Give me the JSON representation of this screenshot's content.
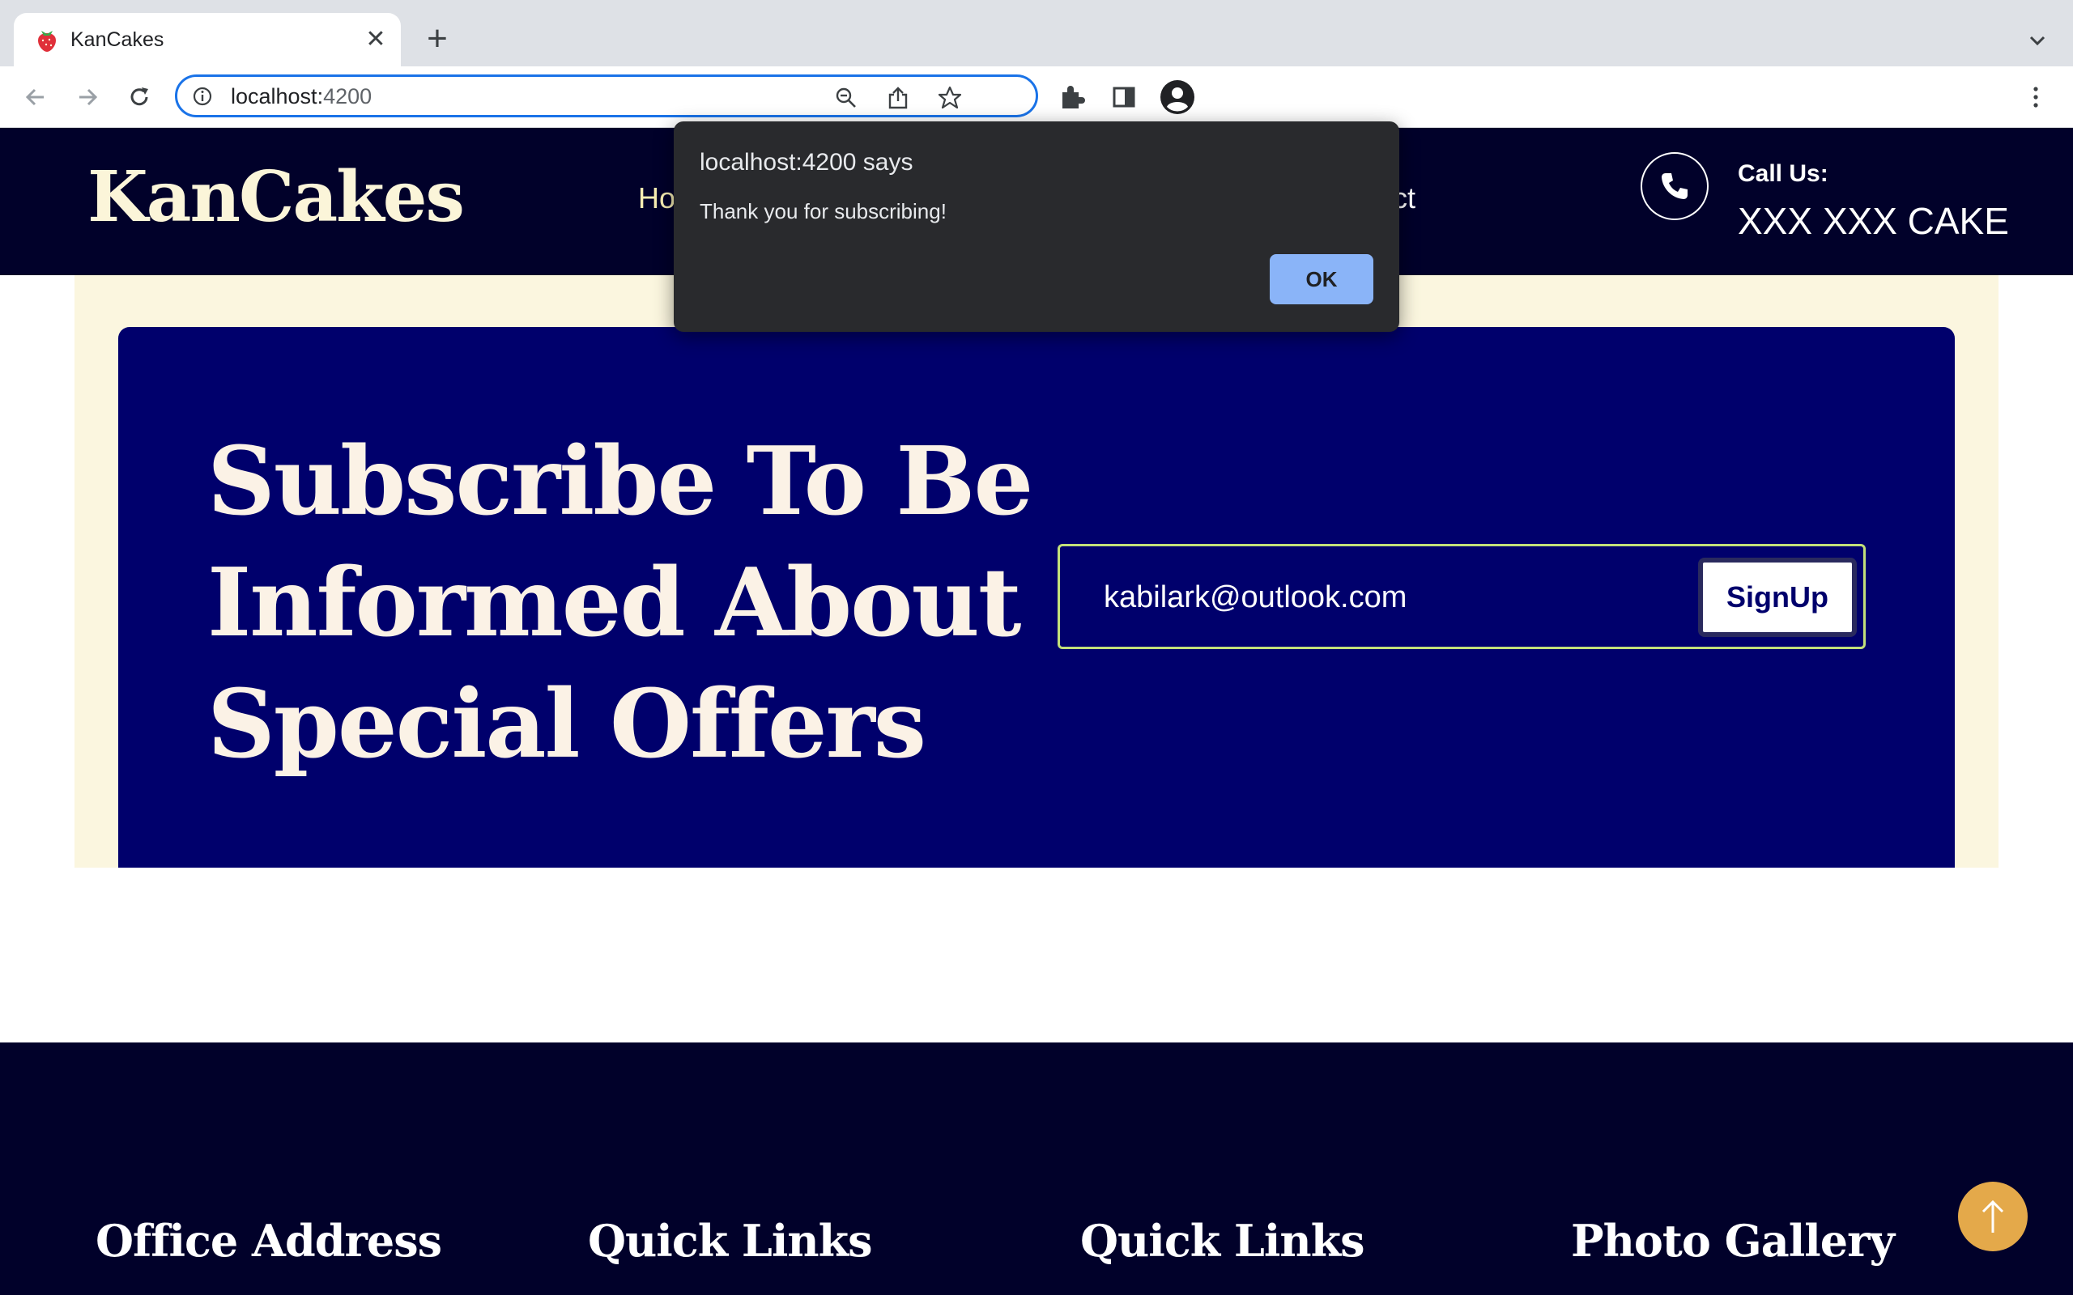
{
  "browser": {
    "tab_title": "KanCakes",
    "new_tab_symbol": "+",
    "close_symbol": "✕",
    "url_host": "localhost:",
    "url_port": "4200",
    "icons": [
      "back-icon",
      "forward-icon",
      "reload-icon",
      "site-info-icon",
      "zoom-out-icon",
      "share-icon",
      "bookmark-star-icon",
      "extensions-icon",
      "side-panel-icon",
      "profile-icon",
      "menu-icon",
      "tab-search-icon",
      "strawberry-favicon-icon"
    ]
  },
  "header": {
    "logo": "KanCakes",
    "nav_home_partial": "Ho",
    "nav_contact_partial": "ntact",
    "call_label": "Call Us:",
    "call_number": "XXX XXX CAKE"
  },
  "subscribe": {
    "heading": "Subscribe To Be Informed About Special Offers",
    "email_value": "kabilark@outlook.com",
    "signup_label": "SignUp"
  },
  "footer": {
    "col1_title": "Office Address",
    "col2_title": "Quick Links",
    "col3_title": "Quick Links",
    "col4_title": "Photo Gallery"
  },
  "dialog": {
    "title": "localhost:4200 says",
    "message": "Thank you for subscribing!",
    "ok_label": "OK"
  },
  "colors": {
    "header_bg": "#01012a",
    "subscribe_bg": "#00006c",
    "cream": "#fbf6df",
    "accent_button": "#e4a94a",
    "dialog_bg": "#292a2d",
    "dialog_ok": "#8ab4f8"
  }
}
